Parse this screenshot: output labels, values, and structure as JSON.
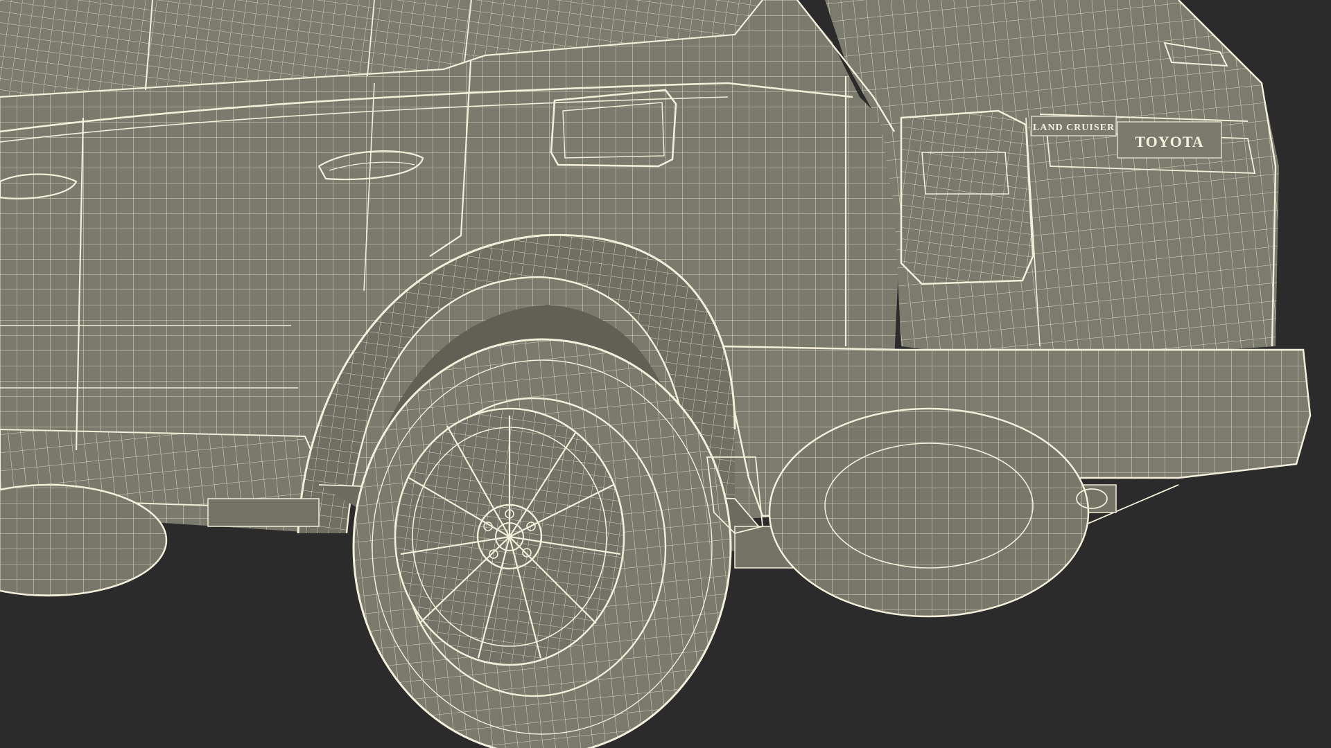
{
  "render": {
    "background_color": "#2b2b2b",
    "body_color": "#7b7b6d",
    "wire_color": "#e9e6cf"
  },
  "vehicle_badges": {
    "model_badge": "LAND CRUISER",
    "brand_badge": "TOYOTA"
  }
}
